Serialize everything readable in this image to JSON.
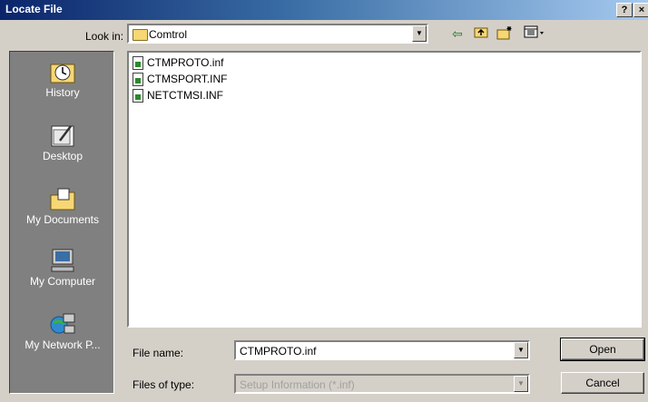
{
  "window": {
    "title": "Locate File",
    "help_label": "?",
    "close_label": "×"
  },
  "lookin": {
    "label": "Look in:",
    "value": "Comtrol"
  },
  "toolbar": {
    "back_icon": "back-arrow-icon",
    "up_icon": "up-folder-icon",
    "new_folder_icon": "new-folder-icon",
    "views_icon": "views-menu-icon"
  },
  "places": [
    {
      "label": "History",
      "icon": "history-icon"
    },
    {
      "label": "Desktop",
      "icon": "desktop-icon"
    },
    {
      "label": "My Documents",
      "icon": "my-documents-icon"
    },
    {
      "label": "My Computer",
      "icon": "my-computer-icon"
    },
    {
      "label": "My Network P...",
      "icon": "my-network-icon"
    }
  ],
  "files": [
    {
      "name": "CTMPROTO.inf"
    },
    {
      "name": "CTMSPORT.INF"
    },
    {
      "name": "NETCTMSI.INF"
    }
  ],
  "filename": {
    "label": "File name:",
    "value": "CTMPROTO.inf"
  },
  "filetype": {
    "label": "Files of type:",
    "value": "Setup Information (*.inf)"
  },
  "buttons": {
    "open": "Open",
    "cancel": "Cancel"
  },
  "colors": {
    "title_bar_start": "#0a246a",
    "title_bar_end": "#a6caf0",
    "dialog_bg": "#d4d0c8",
    "places_bg": "#808080"
  }
}
